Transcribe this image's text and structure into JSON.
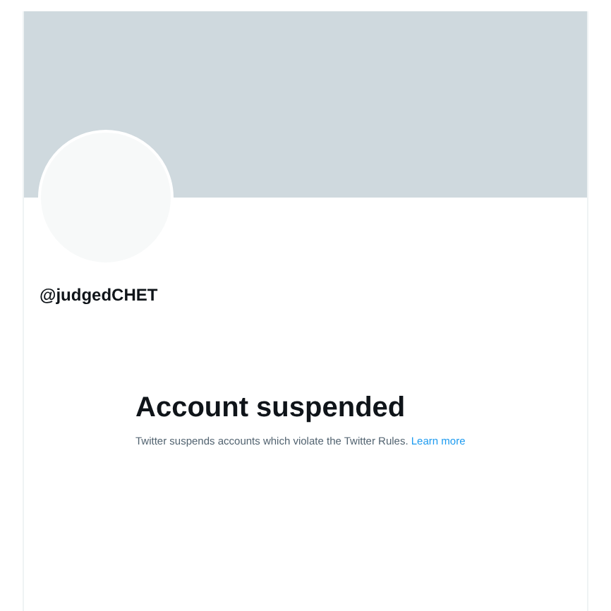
{
  "profile": {
    "handle": "@judgedCHET"
  },
  "notice": {
    "title": "Account suspended",
    "body": "Twitter suspends accounts which violate the Twitter Rules.",
    "link": "Learn more"
  }
}
